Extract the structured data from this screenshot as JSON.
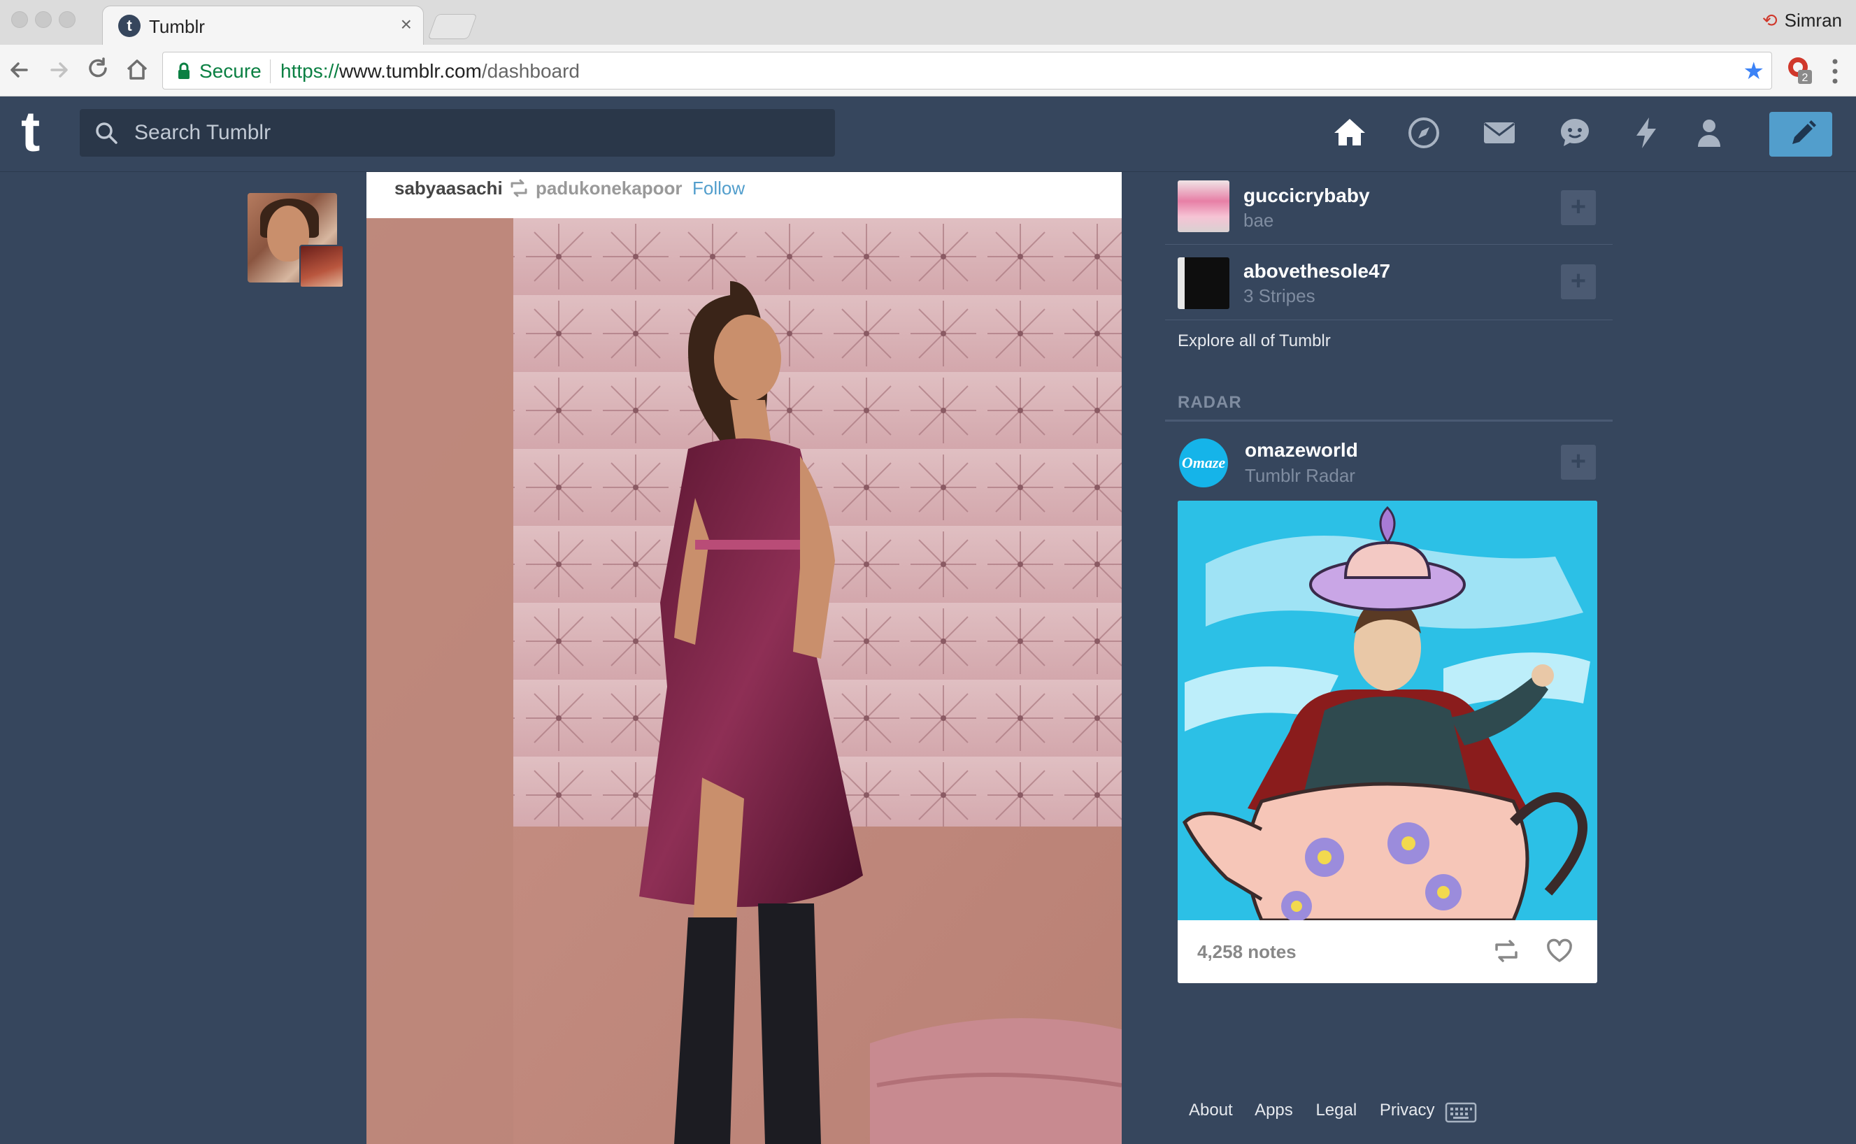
{
  "browser": {
    "tab_title": "Tumblr",
    "tab_close": "×",
    "profile_name": "Simran",
    "secure_label": "Secure",
    "url_scheme": "https://",
    "url_host": "www.tumblr.com",
    "url_path": "/dashboard",
    "extension_badge": "2"
  },
  "tumblr": {
    "logo": "t",
    "search_placeholder": "Search Tumblr",
    "nav_icons": [
      "home-icon",
      "explore-icon",
      "inbox-icon",
      "messaging-icon",
      "activity-icon",
      "account-icon",
      "compose-icon"
    ],
    "accent_color": "#529ecc",
    "bg_color": "#36465d"
  },
  "post": {
    "author": "sabyaasachi",
    "source": "padukonekapoor",
    "follow_label": "Follow"
  },
  "recommended": [
    {
      "name": "guccicrybaby",
      "subtitle": "bae"
    },
    {
      "name": "abovethesole47",
      "subtitle": "3 Stripes"
    }
  ],
  "explore_label": "Explore all of Tumblr",
  "radar": {
    "title": "RADAR",
    "blog_name": "omazeworld",
    "blog_sub": "Tumblr Radar",
    "avatar_text": "Omaze",
    "notes": "4,258 notes"
  },
  "footer": {
    "about": "About",
    "apps": "Apps",
    "legal": "Legal",
    "privacy": "Privacy"
  }
}
